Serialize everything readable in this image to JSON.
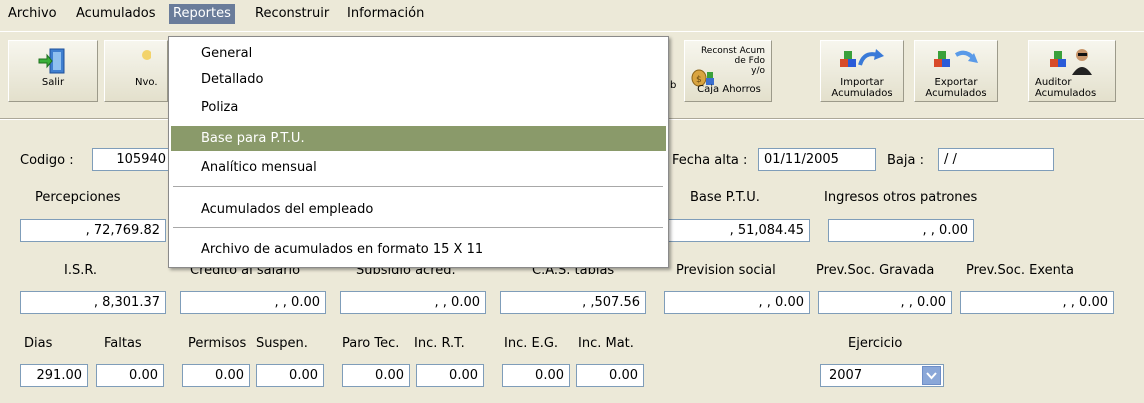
{
  "menubar": {
    "items": [
      {
        "label": "Archivo"
      },
      {
        "label": "Acumulados"
      },
      {
        "label": "Reportes"
      },
      {
        "label": "Reconstruir"
      },
      {
        "label": "Información"
      }
    ]
  },
  "toolbar": {
    "salir": "Salir",
    "nvo": "Nvo.",
    "reconst_line1": "Reconst Acum",
    "reconst_line2": "de Fdo",
    "reconst_line3": "y/o",
    "reconst_line4": "Caja Ahorros",
    "importar_line1": "Importar",
    "importar_line2": "Acumulados",
    "exportar_line1": "Exportar",
    "exportar_line2": "Acumulados",
    "auditor_line1": "Auditor",
    "auditor_line2": "Acumulados",
    "partial_b": "b"
  },
  "reportes_menu": {
    "items": [
      {
        "label": "General"
      },
      {
        "label": "Detallado"
      },
      {
        "label": "Poliza"
      },
      {
        "label": "Base para P.T.U."
      },
      {
        "label": "Analítico mensual"
      },
      {
        "label": "Acumulados del empleado"
      },
      {
        "label": "Archivo de acumulados en formato 15 X 11"
      }
    ]
  },
  "form": {
    "codigo_label": "Codigo :",
    "codigo_value": "105940",
    "fecha_alta_label": "Fecha alta :",
    "fecha_alta_value": "01/11/2005",
    "baja_label": "Baja :",
    "baja_value": "/ /",
    "percepciones_label": "Percepciones",
    "percepciones_value": ", 72,769.82",
    "base_ptu_label": "Base P.T.U.",
    "base_ptu_value": ", 51,084.45",
    "ingresos_label": "Ingresos otros patrones",
    "ingresos_value": ", , 0.00",
    "isr_label": "I.S.R.",
    "isr_value": ", 8,301.37",
    "credito_label": "Credito al salario",
    "credito_value": ", , 0.00",
    "subsidio_label": "Subsidio acred.",
    "subsidio_value": ", , 0.00",
    "cas_label": "C.A.S. tablas",
    "cas_value": ", ,507.56",
    "prevision_label": "Prevision social",
    "prevision_value": ", , 0.00",
    "prevgrav_label": "Prev.Soc. Gravada",
    "prevgrav_value": ", , 0.00",
    "prevexenta_label": "Prev.Soc. Exenta",
    "prevexenta_value": ", , 0.00",
    "dias_label": "Dias",
    "dias_value": "291.00",
    "faltas_label": "Faltas",
    "faltas_value": "0.00",
    "permisos_label": "Permisos",
    "permisos_value": "0.00",
    "suspen_label": "Suspen.",
    "suspen_value": "0.00",
    "parotec_label": "Paro Tec.",
    "parotec_value": "0.00",
    "incrt_label": "Inc. R.T.",
    "incrt_value": "0.00",
    "inceg_label": "Inc. E.G.",
    "inceg_value": "0.00",
    "incmat_label": "Inc. Mat.",
    "incmat_value": "0.00",
    "ejercicio_label": "Ejercicio",
    "ejercicio_value": "2007"
  },
  "icons": {
    "salir": "exit-door-icon",
    "nvo": "new-icon",
    "reconst": "money-bag-icon",
    "importar": "import-icon",
    "exportar": "export-icon",
    "auditor": "auditor-icon",
    "combo": "chevron-down-icon"
  },
  "colors": {
    "window_bg": "#ece9d8",
    "menu_active_bg": "#6a7c9a",
    "menu_highlight_bg": "#8a9a6a",
    "field_border": "#7f9db9"
  }
}
